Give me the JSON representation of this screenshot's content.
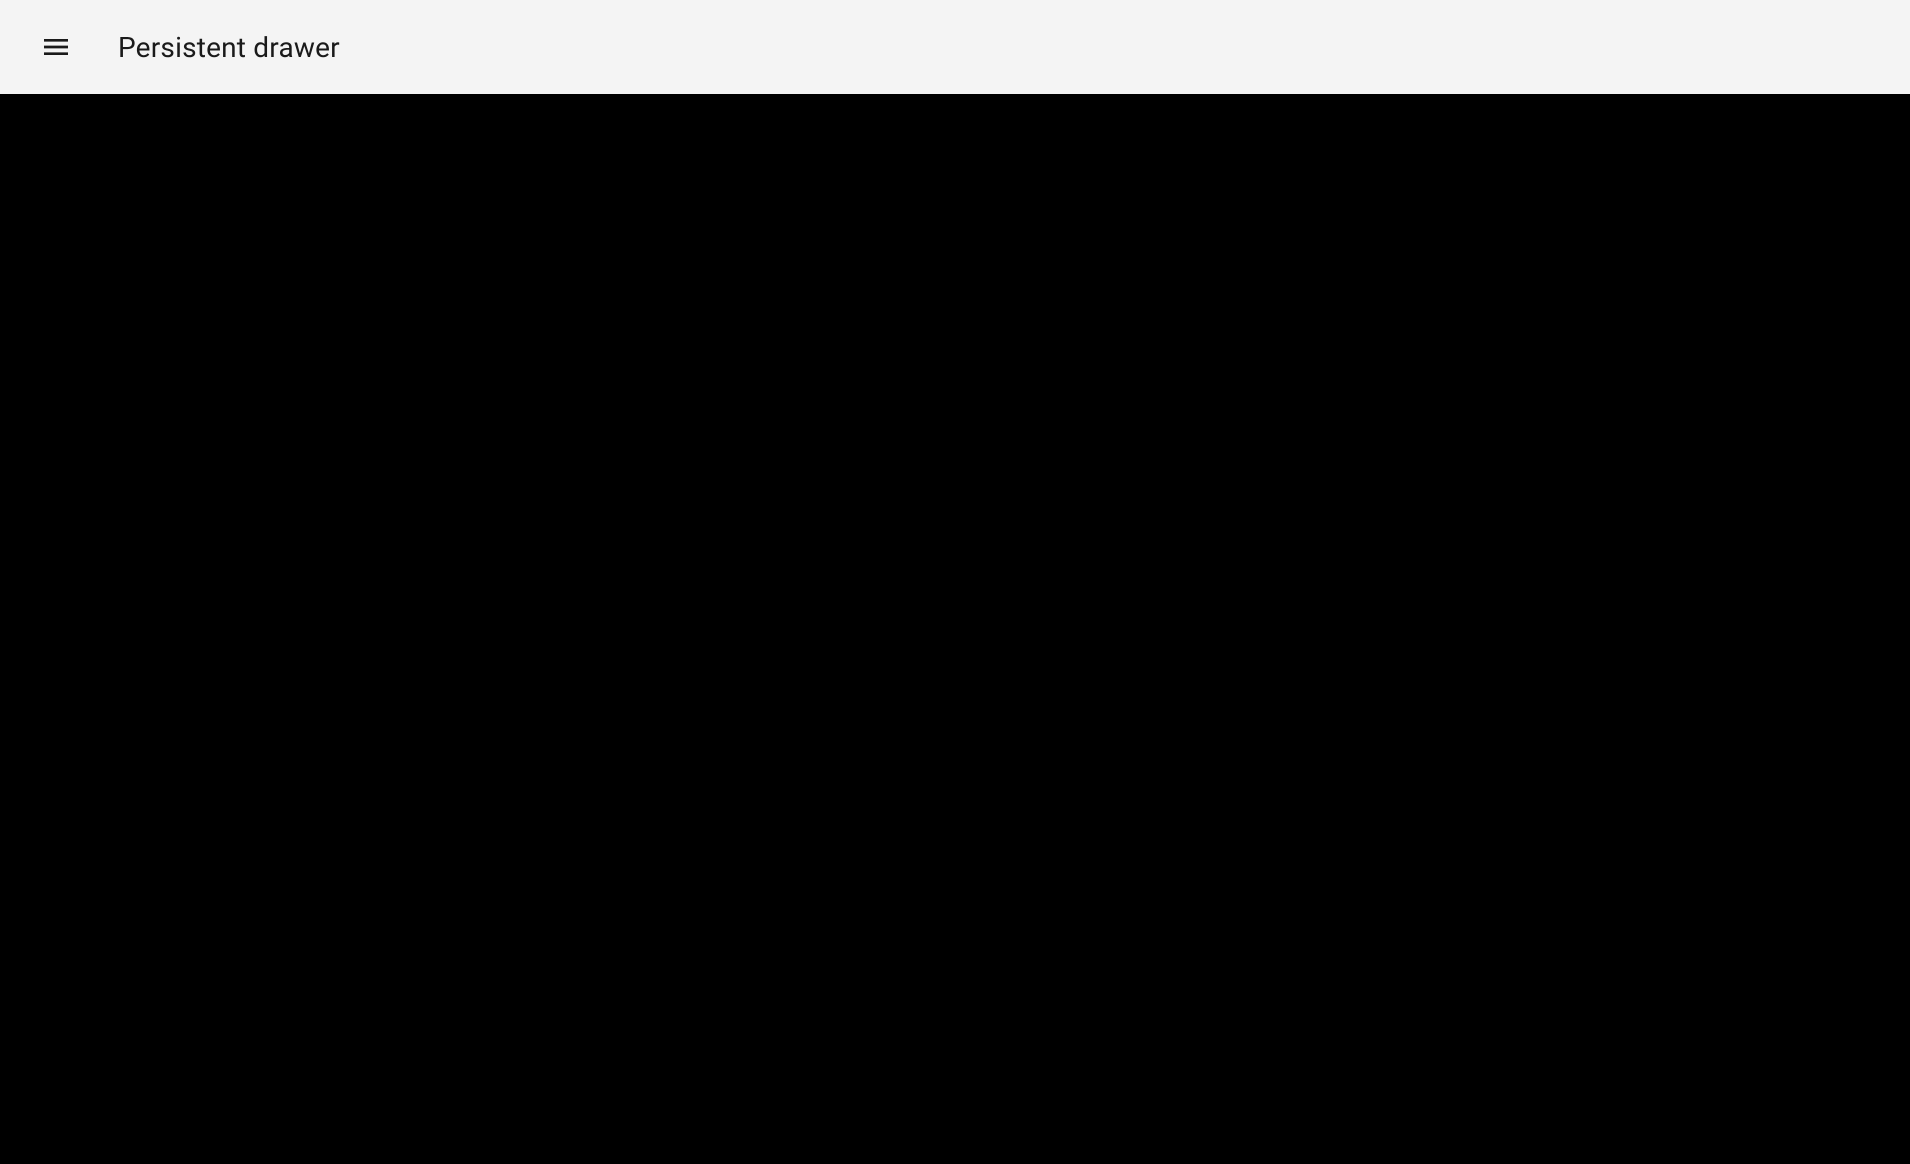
{
  "header": {
    "title": "Persistent drawer"
  }
}
